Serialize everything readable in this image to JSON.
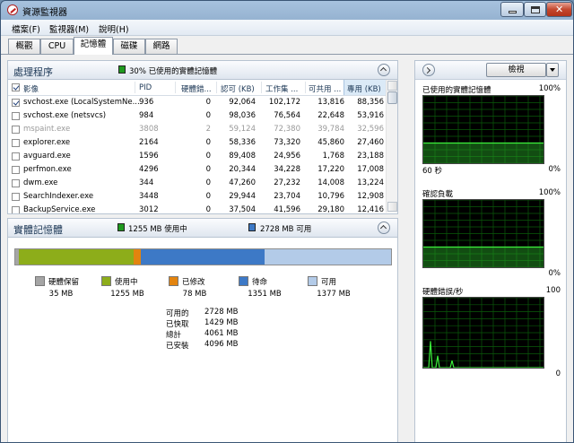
{
  "window": {
    "title": "資源監視器"
  },
  "menu": [
    "檔案(F)",
    "監視器(M)",
    "說明(H)"
  ],
  "tabs": [
    "概觀",
    "CPU",
    "記憶體",
    "磁碟",
    "網路"
  ],
  "active_tab": 2,
  "processes": {
    "title": "處理程序",
    "summary": "30% 已使用的實體記憶體",
    "summary_color": "#1f9a1f",
    "columns": [
      "影像",
      "PID",
      "硬體錯...",
      "認可 (KB)",
      "工作集 ...",
      "可共用 ...",
      "專用 (KB)"
    ],
    "sorted_column": 6,
    "rows": [
      {
        "name": "svchost.exe (LocalSystemNe...",
        "pid": "936",
        "faults": "0",
        "commit": "92,064",
        "working": "102,172",
        "shareable": "13,816",
        "private": "88,356",
        "checked": true,
        "grey": false
      },
      {
        "name": "svchost.exe (netsvcs)",
        "pid": "984",
        "faults": "0",
        "commit": "98,036",
        "working": "76,564",
        "shareable": "22,648",
        "private": "53,916",
        "checked": false,
        "grey": false
      },
      {
        "name": "mspaint.exe",
        "pid": "3808",
        "faults": "2",
        "commit": "59,124",
        "working": "72,380",
        "shareable": "39,784",
        "private": "32,596",
        "checked": false,
        "grey": true
      },
      {
        "name": "explorer.exe",
        "pid": "2164",
        "faults": "0",
        "commit": "58,336",
        "working": "73,320",
        "shareable": "45,860",
        "private": "27,460",
        "checked": false,
        "grey": false
      },
      {
        "name": "avguard.exe",
        "pid": "1596",
        "faults": "0",
        "commit": "89,408",
        "working": "24,956",
        "shareable": "1,768",
        "private": "23,188",
        "checked": false,
        "grey": false
      },
      {
        "name": "perfmon.exe",
        "pid": "4296",
        "faults": "0",
        "commit": "20,344",
        "working": "34,228",
        "shareable": "17,220",
        "private": "17,008",
        "checked": false,
        "grey": false
      },
      {
        "name": "dwm.exe",
        "pid": "344",
        "faults": "0",
        "commit": "47,260",
        "working": "27,232",
        "shareable": "14,008",
        "private": "13,224",
        "checked": false,
        "grey": false
      },
      {
        "name": "SearchIndexer.exe",
        "pid": "3448",
        "faults": "0",
        "commit": "29,944",
        "working": "23,704",
        "shareable": "10,796",
        "private": "12,908",
        "checked": false,
        "grey": false
      },
      {
        "name": "BackupService.exe",
        "pid": "3012",
        "faults": "0",
        "commit": "37,504",
        "working": "41,596",
        "shareable": "29,180",
        "private": "12,416",
        "checked": false,
        "grey": false
      }
    ]
  },
  "physical_memory": {
    "title": "實體記憶體",
    "in_use_summary": "1255 MB 使用中",
    "available_summary": "2728 MB 可用",
    "segments": [
      {
        "label": "硬體保留",
        "value": "35 MB",
        "mb": 35,
        "color": "#a5a5a5"
      },
      {
        "label": "使用中",
        "value": "1255 MB",
        "mb": 1255,
        "color": "#8dad1a"
      },
      {
        "label": "已修改",
        "value": "78 MB",
        "mb": 78,
        "color": "#e3840f"
      },
      {
        "label": "待命",
        "value": "1351 MB",
        "mb": 1351,
        "color": "#3d79c6"
      },
      {
        "label": "可用",
        "value": "1377 MB",
        "mb": 1377,
        "color": "#b3cbe8"
      }
    ],
    "summary": [
      {
        "label": "可用的",
        "value": "2728 MB"
      },
      {
        "label": "已快取",
        "value": "1429 MB"
      },
      {
        "label": "總計",
        "value": "4061 MB"
      },
      {
        "label": "已安裝",
        "value": "4096 MB"
      }
    ]
  },
  "right_panel": {
    "view_label": "檢視",
    "graphs": [
      {
        "title": "已使用的實體記憶體",
        "max": "100%",
        "left_footer": "60 秒",
        "min": "0%",
        "trend": 30
      },
      {
        "title": "確認負載",
        "max": "100%",
        "left_footer": "",
        "min": "0%",
        "trend": 30
      },
      {
        "title": "硬體錯誤/秒",
        "max": "100",
        "left_footer": "",
        "min": "0",
        "trend": 0
      }
    ]
  }
}
